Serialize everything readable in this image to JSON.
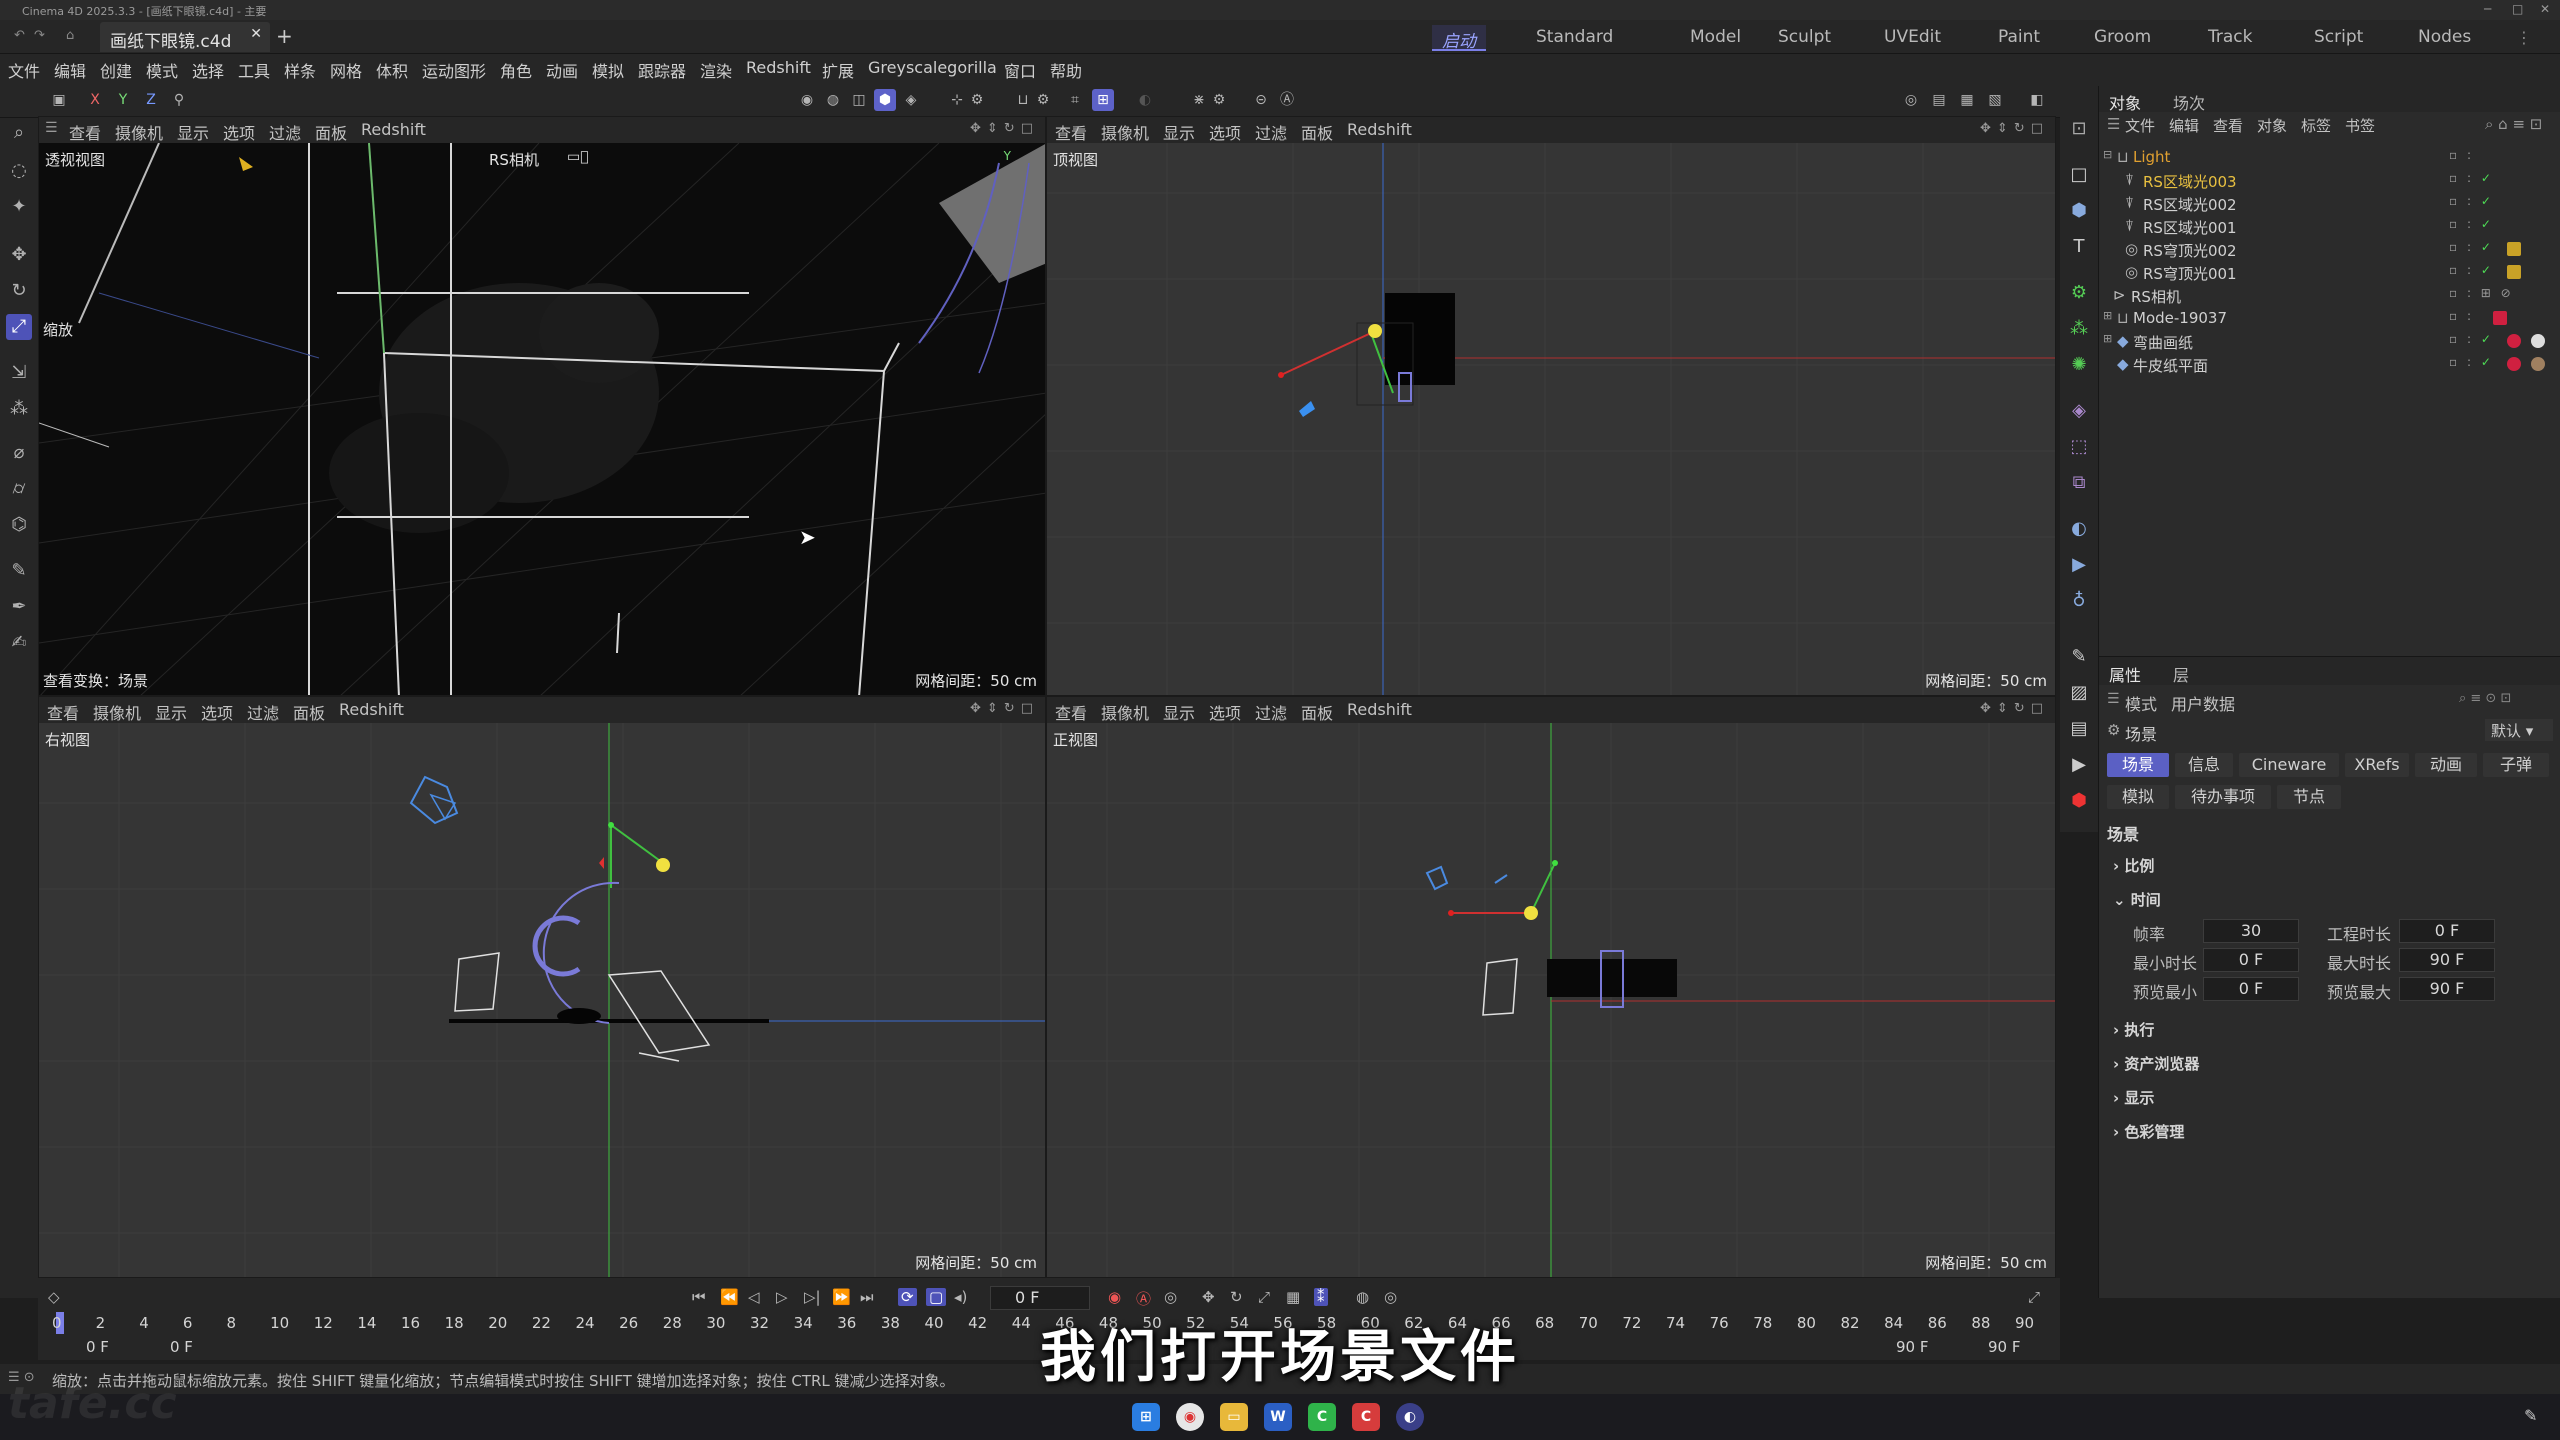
{
  "app": {
    "window_title": "Cinema 4D 2025.3.3 - [画纸下眼镜.c4d] - 主要",
    "doc_tab": "画纸下眼镜.c4d",
    "new_tab": "+"
  },
  "layout_tabs": [
    "启动",
    "Standard",
    "Model",
    "Sculpt",
    "UVEdit",
    "Paint",
    "Groom",
    "Track",
    "Script",
    "Nodes"
  ],
  "active_layout": 0,
  "menu": [
    "文件",
    "编辑",
    "创建",
    "模式",
    "选择",
    "工具",
    "样条",
    "网格",
    "体积",
    "运动图形",
    "角色",
    "动画",
    "模拟",
    "跟踪器",
    "渲染",
    "Redshift",
    "扩展",
    "Greyscalegorilla",
    "窗口",
    "帮助"
  ],
  "toolbar": {
    "axes": [
      "X",
      "Y",
      "Z"
    ]
  },
  "viewport_menu": [
    "查看",
    "摄像机",
    "显示",
    "选项",
    "过滤",
    "面板",
    "Redshift"
  ],
  "viewports": [
    {
      "name": "透视视图",
      "camera": "RS相机",
      "zoom_label": "缩放",
      "info": "查看变换：场景",
      "grid": "网格间距：50 cm"
    },
    {
      "name": "顶视图",
      "grid": "网格间距：50 cm"
    },
    {
      "name": "右视图",
      "grid": "网格间距：50 cm"
    },
    {
      "name": "正视图",
      "grid": "网格间距：50 cm"
    }
  ],
  "objects_panel": {
    "tabs": [
      "对象",
      "场次"
    ],
    "menu": [
      "文件",
      "编辑",
      "查看",
      "对象",
      "标签",
      "书签"
    ],
    "items": [
      {
        "label": "Light",
        "indent": 0,
        "color": "#e0a030"
      },
      {
        "label": "RS区域光003",
        "indent": 1,
        "color": "#e8c040"
      },
      {
        "label": "RS区域光002",
        "indent": 1,
        "color": "#d0d0d0"
      },
      {
        "label": "RS区域光001",
        "indent": 1,
        "color": "#d0d0d0"
      },
      {
        "label": "RS穹顶光002",
        "indent": 1,
        "color": "#d0d0d0"
      },
      {
        "label": "RS穹顶光001",
        "indent": 1,
        "color": "#d0d0d0"
      },
      {
        "label": "RS相机",
        "indent": 0,
        "color": "#d0d0d0"
      },
      {
        "label": "Mode-19037",
        "indent": 0,
        "color": "#d0d0d0"
      },
      {
        "label": "弯曲画纸",
        "indent": 0,
        "color": "#d0d0d0"
      },
      {
        "label": "牛皮纸平面",
        "indent": 0,
        "color": "#d0d0d0"
      }
    ]
  },
  "attributes_panel": {
    "tabs": [
      "属性",
      "层"
    ],
    "menu": [
      "模式",
      "用户数据"
    ],
    "context": "场景",
    "preset": "默认",
    "buttons_row1": [
      "场景",
      "信息",
      "Cineware",
      "XRefs",
      "动画",
      "子弹"
    ],
    "buttons_row2": [
      "模拟",
      "待办事项",
      "节点"
    ],
    "section_title": "场景",
    "groups": [
      "比例",
      "时间",
      "执行",
      "资产浏览器",
      "显示",
      "色彩管理"
    ],
    "time_fields": {
      "fps_label": "帧率",
      "fps": "30",
      "project_len_label": "工程时长",
      "project_len": "0 F",
      "min_label": "最小时长",
      "min": "0 F",
      "max_label": "最大时长",
      "max": "90 F",
      "preview_min_label": "预览最小",
      "preview_min": "0 F",
      "preview_max_label": "预览最大",
      "preview_max": "90 F"
    }
  },
  "timeline": {
    "current_frame": "0 F",
    "ticks": [
      "0",
      "2",
      "4",
      "6",
      "8",
      "10",
      "12",
      "14",
      "16",
      "18",
      "20",
      "22",
      "24",
      "26",
      "28",
      "30",
      "32",
      "34",
      "36",
      "38",
      "40",
      "42",
      "44",
      "46",
      "48",
      "50",
      "52",
      "54",
      "56",
      "58",
      "60",
      "62",
      "64",
      "66",
      "68",
      "70",
      "72",
      "74",
      "76",
      "78",
      "80",
      "82",
      "84",
      "86",
      "88",
      "90"
    ],
    "range_start": "0 F",
    "range_start2": "0 F",
    "range_end": "90 F",
    "range_end2": "90 F"
  },
  "status_text": "缩放：点击并拖动鼠标缩放元素。按住 SHIFT 键量化缩放；节点编辑模式时按住 SHIFT 键增加选择对象；按住 CTRL 键减少选择对象。",
  "subtitle": "我们打开场景文件",
  "taskbar_icons": [
    "windows-icon",
    "chrome-icon",
    "explorer-icon",
    "word-icon",
    "wechat-icon",
    "app-icon",
    "cinema4d-icon"
  ]
}
